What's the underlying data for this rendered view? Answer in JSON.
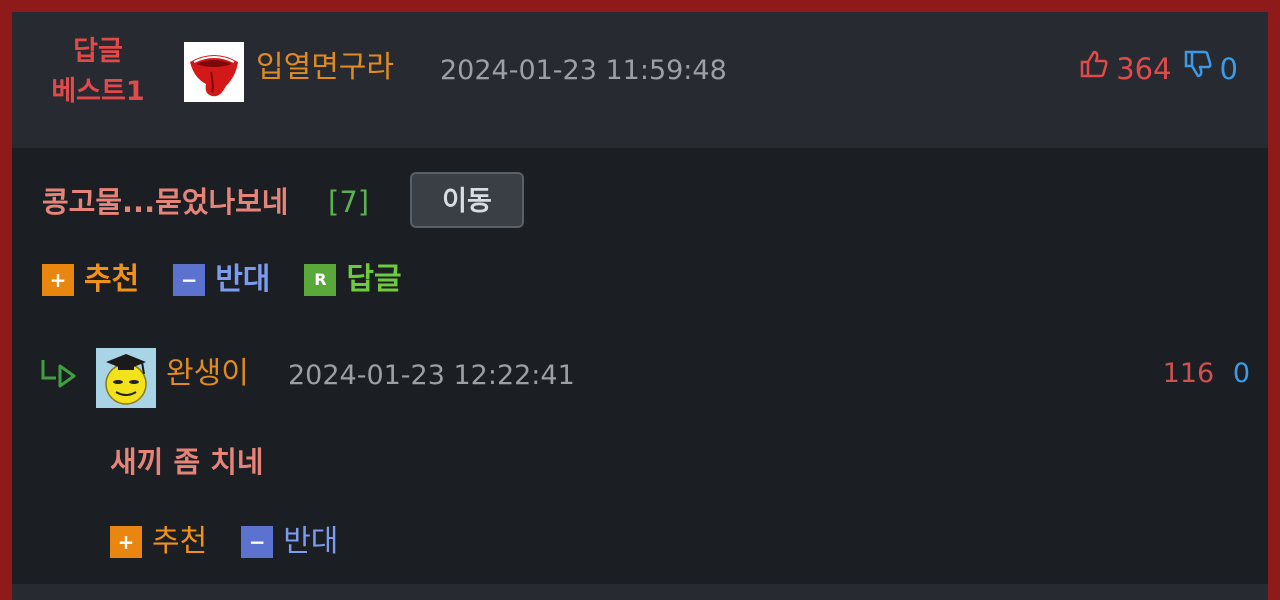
{
  "best_comment": {
    "badge_line1": "답글",
    "badge_line2": "베스트1",
    "author": "입열면구라",
    "date": "2024-01-23 11:59:48",
    "upvotes": "364",
    "downvotes": "0",
    "text": "콩고물...묻었나보네",
    "reply_count": "[7]",
    "move_button_label": "이동",
    "actions": {
      "recommend": "추천",
      "oppose": "반대",
      "reply": "답글",
      "recommend_icon": "+",
      "oppose_icon": "−",
      "reply_icon": "R"
    }
  },
  "reply": {
    "author": "완생이",
    "date": "2024-01-23 12:22:41",
    "upvotes": "116",
    "downvotes": "0",
    "text": "새끼 좀 치네",
    "actions": {
      "recommend": "추천",
      "oppose": "반대",
      "recommend_icon": "+",
      "oppose_icon": "−"
    }
  },
  "colors": {
    "frame": "#8e1a1a",
    "header_bg": "#272b31",
    "body_bg": "#1b1e22",
    "author": "#e08a20",
    "upvote": "#e24a4a",
    "downvote": "#3b9be8"
  },
  "icons": {
    "author1_avatar": "tongue-logo-icon",
    "author2_avatar": "graduate-smiley-icon",
    "thumbs_up": "thumbs-up-icon",
    "thumbs_down": "thumbs-down-icon",
    "reply_arrow": "reply-arrow-icon"
  }
}
